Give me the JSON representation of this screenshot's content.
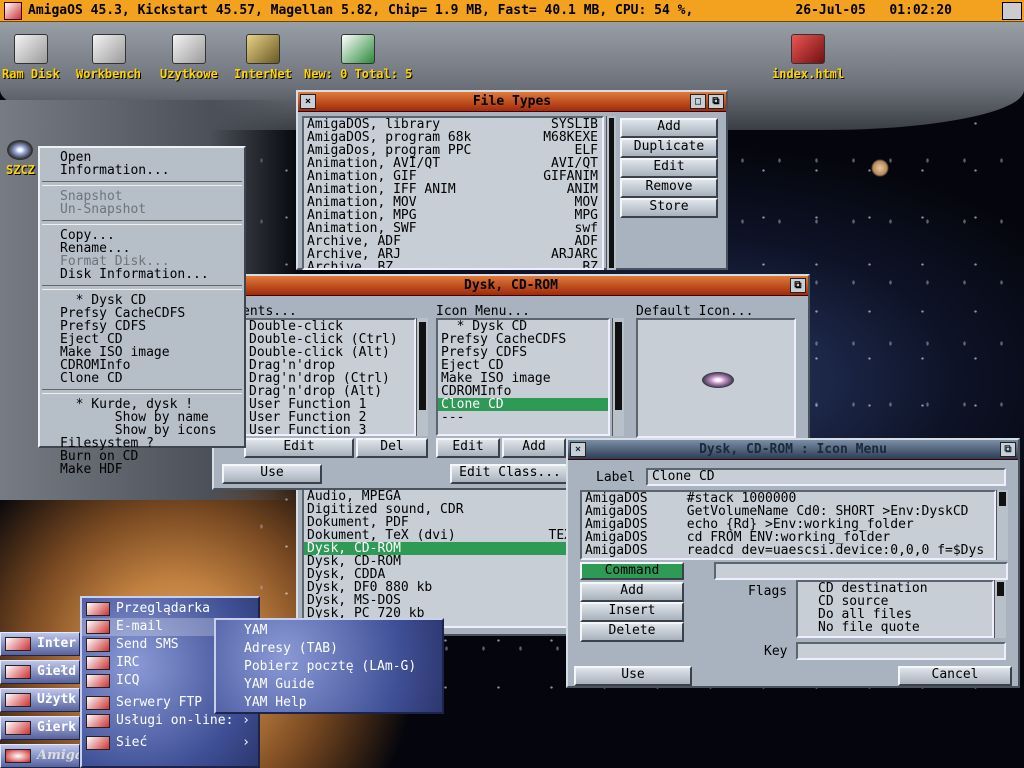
{
  "screen": {
    "title": "AmigaOS 45.3, Kickstart 45.57, Magellan 5.82, Chip= 1.9 MB, Fast= 40.1 MB, CPU: 54 %,",
    "date": "26-Jul-05",
    "time": "01:02:20"
  },
  "desktop": {
    "icons": [
      {
        "label": "Ram Disk",
        "icon": "ram-disk-icon"
      },
      {
        "label": "Workbench",
        "icon": "disk-icon"
      },
      {
        "label": "Uzytkowe",
        "icon": "disk-icon"
      },
      {
        "label": "InterNet",
        "icon": "satellite-icon"
      },
      {
        "label": "New: 0 Total: 5",
        "icon": "mailbox-icon"
      },
      {
        "label": "index.html",
        "icon": "html-file-icon"
      },
      {
        "label": "SZCZ",
        "icon": "cd-icon"
      }
    ]
  },
  "file_types": {
    "title": "File Types",
    "rows": [
      [
        "AmigaDOS, library",
        "SYSLIB"
      ],
      [
        "AmigaDOS, program 68k",
        "M68KEXE"
      ],
      [
        "AmigaDos, program PPC",
        "ELF"
      ],
      [
        "Animation, AVI/QT",
        "AVI/QT"
      ],
      [
        "Animation, GIF",
        "GIFANIM"
      ],
      [
        "Animation, IFF ANIM",
        "ANIM"
      ],
      [
        "Animation, MOV",
        "MOV"
      ],
      [
        "Animation, MPG",
        "MPG"
      ],
      [
        "Animation, SWF",
        "swf"
      ],
      [
        "Archive, ADF",
        "ADF"
      ],
      [
        "Archive, ARJ",
        "ARJARC"
      ],
      [
        "Archive, BZ",
        "BZ"
      ]
    ],
    "buttons": [
      "Add",
      "Duplicate",
      "Edit",
      "Remove",
      "Store"
    ],
    "rows2": [
      "Audio, MPEGA",
      "Digitized sound, CDR",
      "Dokument, PDF",
      "Dokument, TeX (dvi)",
      "Dysk, CD-ROM",
      "Dysk, CD-ROM",
      "Dysk, CDDA",
      "Dysk, DF0 880 kb",
      "Dysk, MS-DOS",
      "Dysk, PC 720 kb"
    ],
    "rows2_right": [
      "",
      "",
      "",
      "TEX",
      "",
      "",
      "",
      "",
      "",
      ""
    ],
    "selected_index": 4
  },
  "dysk": {
    "title": "Dysk, CD-ROM",
    "events_label": "ents...",
    "events": [
      "Double-click",
      "Double-click (Ctrl)",
      "Double-click (Alt)",
      "Drag'n'drop",
      "Drag'n'drop (Ctrl)",
      "Drag'n'drop (Alt)",
      "User Function 1",
      "User Function 2",
      "User Function 3"
    ],
    "icon_menu_label": "Icon Menu...",
    "icon_menu": [
      "  * Dysk CD",
      "Prefsy CacheCDFS",
      "Prefsy CDFS",
      "Eject CD",
      "Make ISO image",
      "CDROMInfo",
      "Clone CD",
      "---"
    ],
    "icon_menu_selected": 6,
    "default_icon_label": "Default Icon...",
    "edit": "Edit",
    "del": "Del",
    "edit2": "Edit",
    "add": "Add",
    "use": "Use",
    "edit_class": "Edit Class..."
  },
  "iconmenu_win": {
    "title": "Dysk, CD-ROM : Icon Menu",
    "label_caption": "Label",
    "label_value": "Clone CD",
    "commands": [
      [
        "AmigaDOS",
        "#stack 1000000"
      ],
      [
        "AmigaDOS",
        "GetVolumeName Cd0: SHORT >Env:DyskCD"
      ],
      [
        "AmigaDOS",
        "echo {Rd} >Env:working_folder"
      ],
      [
        "AmigaDOS",
        "cd FROM ENV:working_folder"
      ],
      [
        "AmigaDOS",
        "readcd dev=uaescsi.device:0,0,0 f=$Dys"
      ]
    ],
    "type_select": "Command",
    "add": "Add",
    "insert": "Insert",
    "delete": "Delete",
    "flags_label": "Flags",
    "flags": [
      "CD destination",
      "CD source",
      "Do all files",
      "No file quote"
    ],
    "key_label": "Key",
    "use": "Use",
    "cancel": "Cancel"
  },
  "context_menu": {
    "groups": [
      [
        {
          "t": "Open",
          "d": false
        },
        {
          "t": "Information...",
          "d": false
        }
      ],
      [
        {
          "t": "Snapshot",
          "d": true
        },
        {
          "t": "Un-Snapshot",
          "d": true
        }
      ],
      [
        {
          "t": "Copy...",
          "d": false
        },
        {
          "t": "Rename...",
          "d": false
        },
        {
          "t": "Format Disk...",
          "d": true
        },
        {
          "t": "Disk Information...",
          "d": false
        }
      ],
      [
        {
          "t": "  * Dysk CD",
          "d": false
        },
        {
          "t": "Prefsy CacheCDFS",
          "d": false
        },
        {
          "t": "Prefsy CDFS",
          "d": false
        },
        {
          "t": "Eject CD",
          "d": false
        },
        {
          "t": "Make ISO image",
          "d": false
        },
        {
          "t": "CDROMInfo",
          "d": false
        },
        {
          "t": "Clone CD",
          "d": false
        }
      ],
      [
        {
          "t": "  * Kurde, dysk !",
          "d": false
        },
        {
          "t": "       Show by name",
          "d": false
        },
        {
          "t": "       Show by icons",
          "d": false
        },
        {
          "t": "Filesystem ?",
          "d": false
        },
        {
          "t": "Burn on CD",
          "d": false
        },
        {
          "t": "Make HDF",
          "d": false
        }
      ]
    ]
  },
  "start": {
    "bar": [
      {
        "label": "Inter",
        "icon": "internet-icon"
      },
      {
        "label": "Giełd",
        "icon": "stock-icon"
      },
      {
        "label": "Użytk",
        "icon": "tools-icon"
      },
      {
        "label": "Gierk",
        "icon": "joystick-icon"
      }
    ],
    "logo": "Amiga",
    "sub": [
      {
        "label": "Przeglądarka",
        "arrow": ""
      },
      {
        "label": "E-mail",
        "arrow": "›"
      },
      {
        "label": "Send SMS",
        "arrow": ""
      },
      {
        "label": "IRC",
        "arrow": ""
      },
      {
        "label": "ICQ",
        "arrow": ""
      },
      {
        "label": "Serwery FTP",
        "arrow": ""
      },
      {
        "label": "Usługi on-line:",
        "arrow": "›"
      },
      {
        "label": "Sieć",
        "arrow": "›"
      }
    ],
    "yam": [
      "YAM",
      "Adresy (TAB)",
      "Pobierz pocztę (LAm-G)",
      "YAM Guide",
      "YAM Help"
    ]
  }
}
